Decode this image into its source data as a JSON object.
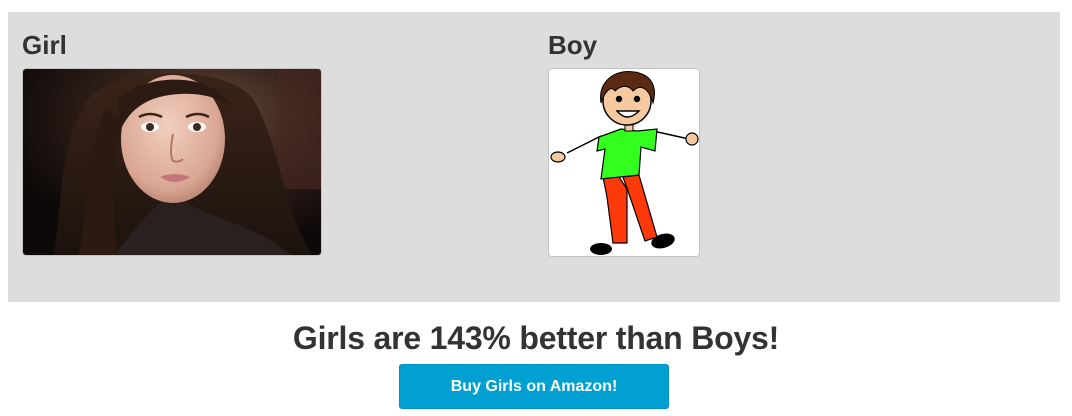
{
  "girl": {
    "heading": "Girl",
    "image": "girl-portrait-photo"
  },
  "boy": {
    "heading": "Boy",
    "image": "boy-stick-figure-drawing"
  },
  "headline": "Girls are 143% better than Boys!",
  "cta": {
    "label": "Buy Girls on Amazon!"
  },
  "colors": {
    "panel": "#dddddd",
    "text": "#333333",
    "button": "#00a0d2",
    "button_text": "#ffffff",
    "shirt": "#33ff1e",
    "pants": "#ff3a0a",
    "skin": "#f6c9a0"
  }
}
